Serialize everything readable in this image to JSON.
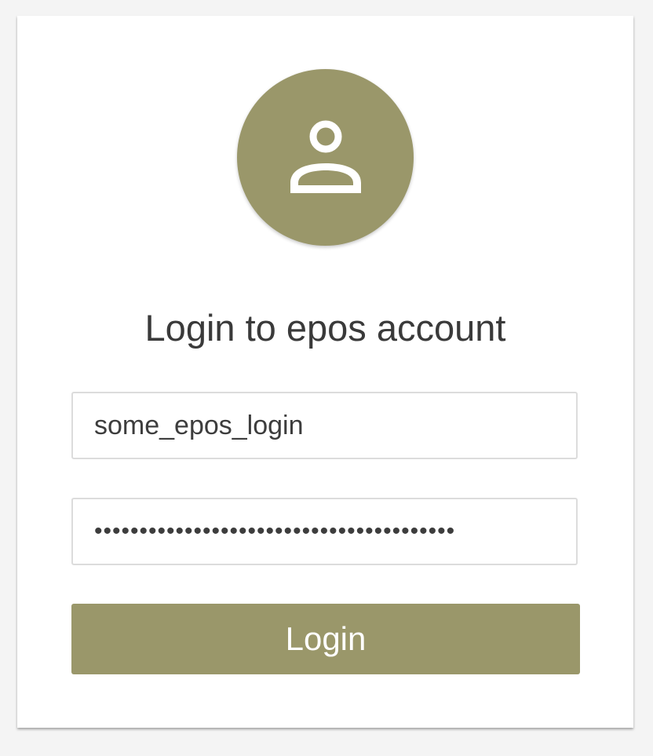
{
  "colors": {
    "accent": "#9a976a",
    "background": "#f4f4f4",
    "card": "#ffffff",
    "text": "#3a3a3a"
  },
  "avatar": {
    "icon": "user-icon"
  },
  "title": "Login to epos account",
  "form": {
    "username_value": "some_epos_login",
    "password_value": "****************************************",
    "login_label": "Login"
  }
}
